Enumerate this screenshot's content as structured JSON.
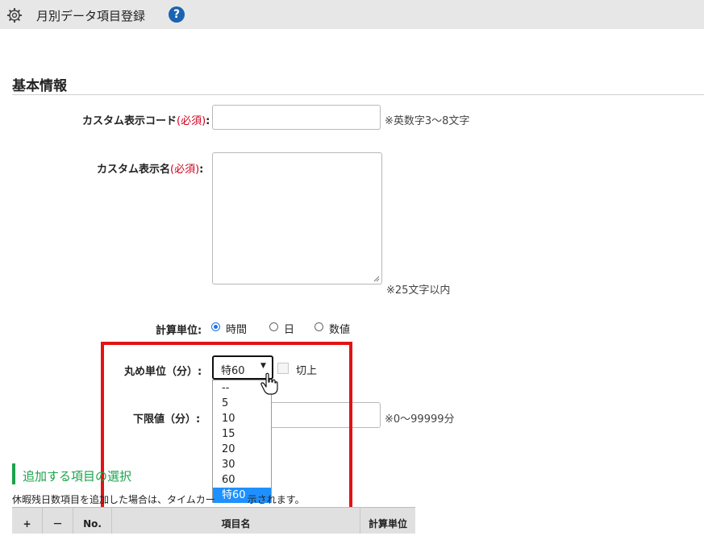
{
  "header": {
    "title": "月別データ項目登録",
    "help_icon": "?"
  },
  "section": {
    "title": "基本情報"
  },
  "form": {
    "code": {
      "label": "カスタム表示コード",
      "required": "(必須)",
      "colon": ":",
      "value": "",
      "note": "※英数字3～8文字"
    },
    "name": {
      "label": "カスタム表示名",
      "required": "(必須)",
      "colon": ":",
      "value": "",
      "note": "※25文字以内"
    },
    "unit": {
      "label": "計算単位:",
      "options": [
        "時間",
        "日",
        "数値"
      ],
      "selected": "時間"
    },
    "rounding": {
      "label": "丸め単位（分）:",
      "selected": "特60",
      "checkbox_label": "切上",
      "checkbox_checked": false,
      "options": [
        "--",
        "5",
        "10",
        "15",
        "20",
        "30",
        "60",
        "特60"
      ]
    },
    "lower_limit": {
      "label": "下限値（分）:",
      "value": "",
      "note": "※0～99999分"
    }
  },
  "additional": {
    "title": "追加する項目の選択",
    "info_left": "休暇残日数項目を",
    "info_middle": "追加した場合は、タイムカー",
    "info_right": "示されます。"
  },
  "table": {
    "headers": [
      "+",
      "－",
      "No.",
      "項目名",
      "計算単位"
    ]
  },
  "colors": {
    "accent": "#1a73e8",
    "highlight": "#e21313",
    "required": "#d0021b",
    "green": "#1aa34a"
  }
}
